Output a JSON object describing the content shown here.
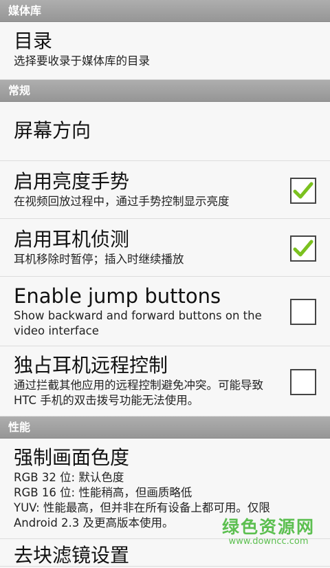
{
  "sections": {
    "media_library": "媒体库",
    "general": "常规",
    "performance": "性能"
  },
  "prefs": {
    "directory": {
      "title": "目录",
      "summary": "选择要收录于媒体库的目录"
    },
    "orientation": {
      "title": "屏幕方向"
    },
    "brightness": {
      "title": "启用亮度手势",
      "summary": "在视频回放过程中，通过手势控制显示亮度",
      "checked": true
    },
    "headset": {
      "title": "启用耳机侦测",
      "summary": "耳机移除时暂停；插入时继续播放",
      "checked": true
    },
    "jump": {
      "title": "Enable jump buttons",
      "summary": "Show backward and forward buttons on the video interface",
      "checked": false
    },
    "remote": {
      "title": "独占耳机远程控制",
      "summary": "通过拦截其他应用的远程控制避免冲突。可能导致 HTC 手机的双击拨号功能无法使用。",
      "checked": false
    },
    "chroma": {
      "title": "强制画面色度",
      "summary_lines": [
        "RGB 32 位: 默认色度",
        "RGB 16 位: 性能稍高，但画质略低",
        "YUV: 性能最高，但并非在所有设备上都可用。仅限",
        "Android 2.3 及更高版本使用。"
      ]
    },
    "next_partial": "去块滤镜设置"
  },
  "watermark": {
    "name": "绿色资源网",
    "url": "www.downcc.com"
  },
  "colors": {
    "check_green": "#7bc11f",
    "watermark": "#4cba3e"
  }
}
